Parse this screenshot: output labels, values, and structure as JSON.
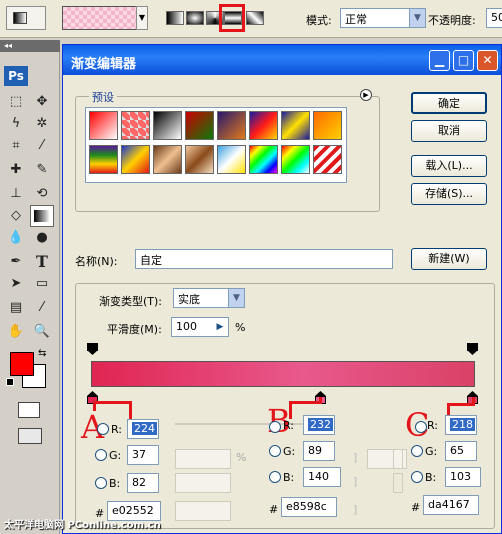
{
  "toolbar": {
    "mode_label": "模式:",
    "mode_value": "正常",
    "opacity_label": "不透明度:",
    "opacity_value": "50"
  },
  "tools": {
    "ps_logo": "Ps",
    "type_tool": "T"
  },
  "dialog": {
    "title": "渐变编辑器",
    "presets_label": "预设",
    "buttons": {
      "ok": "确定",
      "cancel": "取消",
      "load": "载入(L)...",
      "save": "存储(S)...",
      "new": "新建(W)"
    },
    "name_label": "名称(N):",
    "name_value": "自定",
    "gradient_type_label": "渐变类型(T):",
    "gradient_type_value": "实底",
    "smoothness_label": "平滑度(M):",
    "smoothness_value": "100",
    "smoothness_unit": "%",
    "percent": "%"
  },
  "stops": [
    {
      "marker": "A",
      "r": "224",
      "g": "37",
      "b": "82",
      "hex": "e02552"
    },
    {
      "marker": "B",
      "r": "232",
      "g": "89",
      "b": "140",
      "hex": "e8598c"
    },
    {
      "marker": "C",
      "r": "218",
      "g": "65",
      "b": "103",
      "hex": "da4167"
    }
  ],
  "channel_labels": {
    "r": "R:",
    "g": "G:",
    "b": "B:",
    "hash": "#"
  },
  "watermark": "太平洋电脑网 PConline.com.cn",
  "colors": {
    "accent": "#e4141b",
    "gradient_left": "#e02552",
    "gradient_mid": "#e8598c",
    "gradient_right": "#da4167"
  }
}
